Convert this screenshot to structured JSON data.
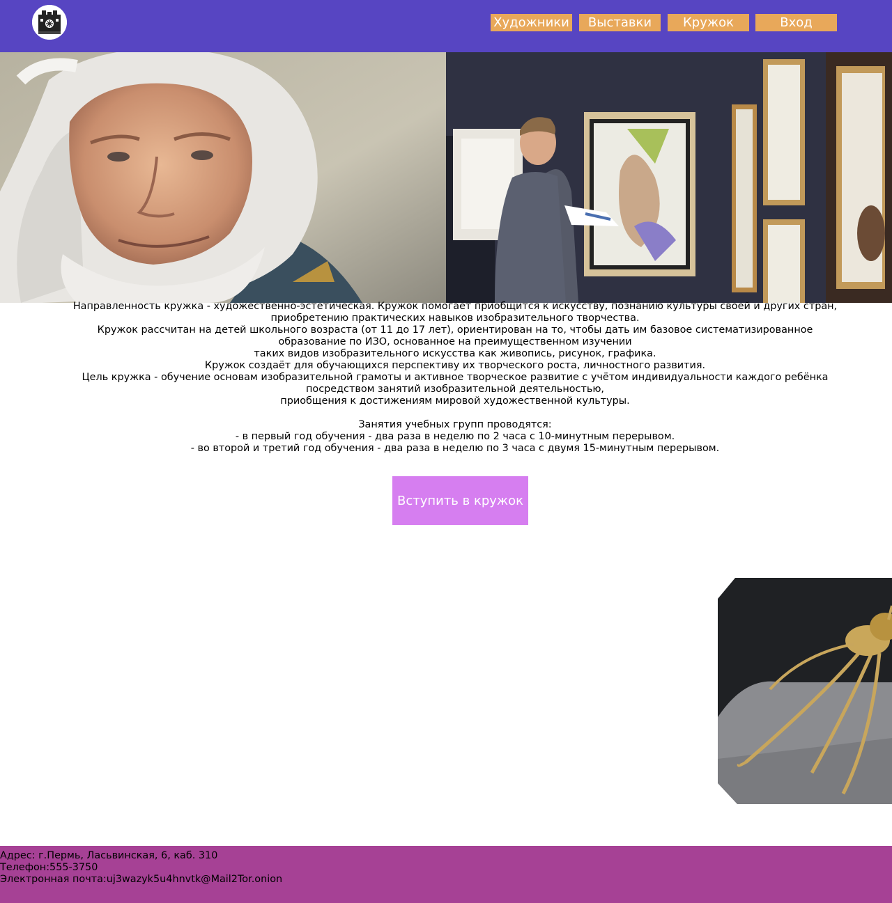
{
  "header": {
    "logo_icon": "building-emblem-icon",
    "background": "#5745c2",
    "nav": [
      {
        "label": "Художники"
      },
      {
        "label": "Выставки"
      },
      {
        "label": "Кружок"
      },
      {
        "label": "Вход"
      }
    ],
    "nav_color": "#e8a85a"
  },
  "hero": {
    "left_image": "portrait-painting-bearded-man",
    "right_image": "man-viewing-gallery-paintings"
  },
  "main": {
    "lines": [
      "Направленность кружка - художественно-эстетическая. Кружок помогает приобщится к искусству, познанию культуры своей и других стран,",
      "приобретению практических навыков изобразительного творчества.",
      "Кружок рассчитан на детей школьного возраста (от 11 до 17 лет), ориентирован на то, чтобы дать им базовое систематизированное",
      "образование по ИЗО, основанное на преимущественном изучении",
      "таких видов изобразительного искусства как живопись, рисунок, графика.",
      "Кружок создаёт для обучающихся перспективу их творческого роста, личностного развития.",
      "Цель кружка - обучение основам изобразительной грамоты и активное творческое развитие с учётом индивидуальности каждого ребёнка",
      "посредством занятий изобразительной деятельностью,",
      "приобщения к достижениям мировой художественной культуры."
    ],
    "schedule_title": "Занятия учебных групп проводятся:",
    "schedule": [
      "- в первый год обучения - два раза в неделю по 2 часа с 10-минутным перерывом.",
      "- во второй и третий год обучения - два раза в неделю по 3 часа с двумя 15-минутным перерывом."
    ],
    "join_button": "Вступить в кружок",
    "join_color": "#d67ef0",
    "side_image": "golden-insect-sculpture"
  },
  "footer": {
    "background": "#a64195",
    "address": "Адрес: г.Пермь, Ласьвинская, 6, каб. 310",
    "phone": "Телефон:555-3750",
    "email": "Электронная почта:uj3wazyk5u4hnvtk@Mail2Tor.onion"
  }
}
